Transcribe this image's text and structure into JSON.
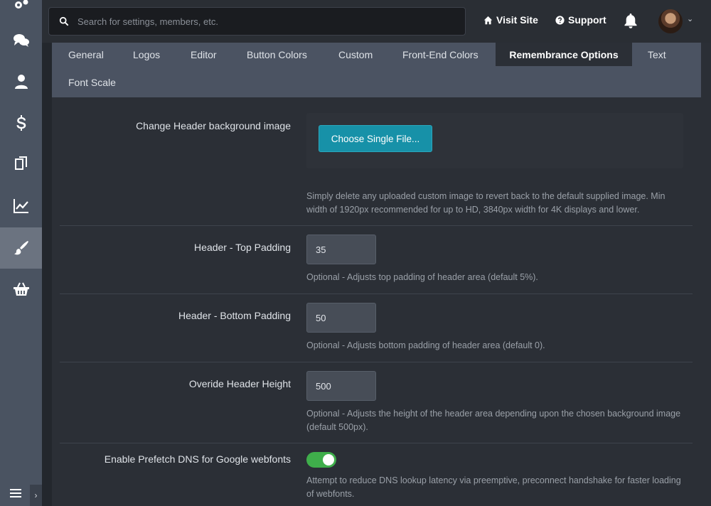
{
  "search": {
    "placeholder": "Search for settings, members, etc."
  },
  "topbar": {
    "visit_site": "Visit Site",
    "support": "Support"
  },
  "tabs": [
    {
      "label": "General"
    },
    {
      "label": "Logos"
    },
    {
      "label": "Editor"
    },
    {
      "label": "Button Colors"
    },
    {
      "label": "Custom"
    },
    {
      "label": "Front-End Colors"
    },
    {
      "label": "Remembrance Options",
      "active": true
    },
    {
      "label": "Text"
    },
    {
      "label": "Font Scale"
    }
  ],
  "settings": {
    "header_image": {
      "label": "Change Header background image",
      "button": "Choose Single File...",
      "help": "Simply delete any uploaded custom image to revert back to the default supplied image. Min width of 1920px recommended for up to HD, 3840px width for 4K displays and lower."
    },
    "top_padding": {
      "label": "Header - Top Padding",
      "value": "35",
      "help": "Optional - Adjusts top padding of header area (default 5%)."
    },
    "bottom_padding": {
      "label": "Header - Bottom Padding",
      "value": "50",
      "help": "Optional - Adjusts bottom padding of header area (default 0)."
    },
    "header_height": {
      "label": "Overide Header Height",
      "value": "500",
      "help": "Optional - Adjusts the height of the header area depending upon the chosen background image (default 500px)."
    },
    "prefetch_dns": {
      "label": "Enable Prefetch DNS for Google webfonts",
      "enabled": true,
      "help": "Attempt to reduce DNS lookup latency via preemptive, preconnect handshake for faster loading of webfonts."
    }
  },
  "sidebar": {
    "items": [
      {
        "icon": "gears-icon"
      },
      {
        "icon": "chat-icon"
      },
      {
        "icon": "user-icon"
      },
      {
        "icon": "dollar-icon"
      },
      {
        "icon": "copy-icon"
      },
      {
        "icon": "chart-line-icon"
      },
      {
        "icon": "paintbrush-icon",
        "active": true
      },
      {
        "icon": "basket-icon"
      }
    ]
  },
  "colors": {
    "accent": "#1791a8",
    "toggle_on": "#3fae4b",
    "sidebar": "#4a5361"
  }
}
